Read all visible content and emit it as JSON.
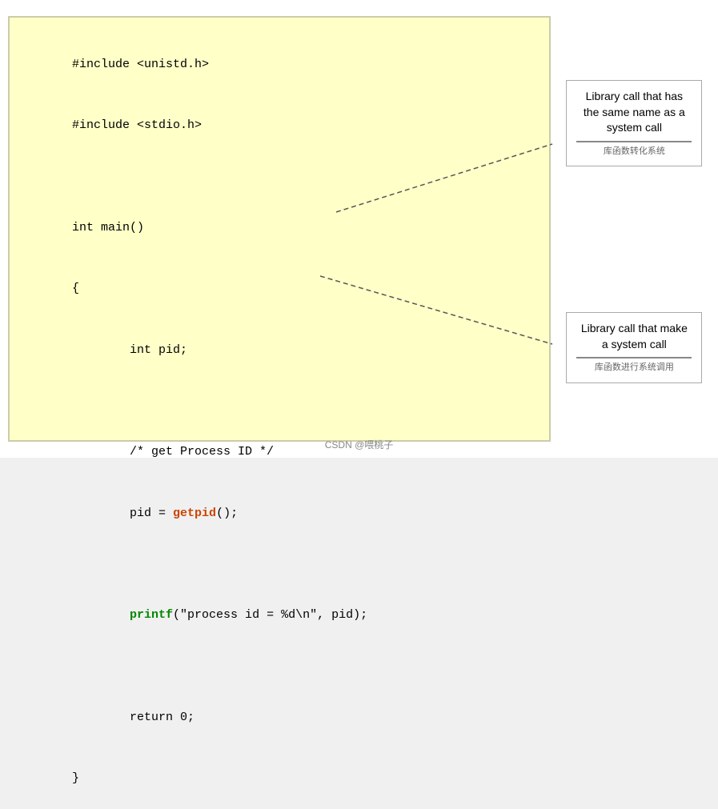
{
  "code": {
    "line1": "#include <unistd.h>",
    "line2": "#include <stdio.h>",
    "line3": "",
    "line4": "int main()",
    "line5": "{",
    "line6": "        int pid;",
    "line7": "",
    "line8": "        /* get Process ID */",
    "line9_pre": "        pid = ",
    "line9_fn": "getpid",
    "line9_post": "();",
    "line10": "",
    "line11_pre": "        ",
    "line11_fn": "printf",
    "line11_post": "(\"process id = %d\\n\", pid);",
    "line12": "",
    "line13": "        return 0;",
    "line14": "}"
  },
  "annotations": {
    "box1": {
      "text": "Library call that has the same name as a system call",
      "chinese": "库函数转化系统"
    },
    "box2": {
      "text": "Library call that make a system call",
      "chinese": "库函数进行系统调用"
    }
  },
  "footer": {
    "text": "CSDN @喂桃子"
  }
}
